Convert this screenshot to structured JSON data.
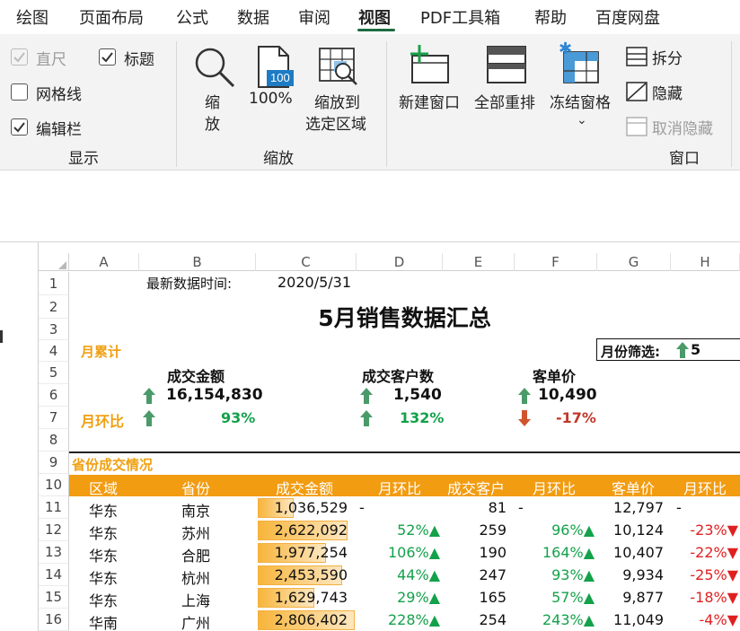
{
  "menu": {
    "items": [
      "绘图",
      "页面布局",
      "公式",
      "数据",
      "审阅",
      "视图",
      "PDF工具箱",
      "帮助",
      "百度网盘"
    ],
    "active": "视图"
  },
  "ribbon": {
    "show": {
      "ruler": "直尺",
      "headings": "标题",
      "gridlines": "网格线",
      "formula_bar": "编辑栏",
      "group_label": "显示"
    },
    "zoom": {
      "zoom_label_1": "缩",
      "zoom_label_2": "放",
      "percent_icon_text": "100",
      "percent_label": "100%",
      "zoom_sel_1": "缩放到",
      "zoom_sel_2": "选定区域",
      "group_label": "缩放"
    },
    "window": {
      "new_window": "新建窗口",
      "arrange_all": "全部重排",
      "freeze_panes": "冻结窗格",
      "split": "拆分",
      "hide": "隐藏",
      "unhide": "取消隐藏",
      "group_label": "窗口"
    }
  },
  "sheet": {
    "columns": [
      "A",
      "B",
      "C",
      "D",
      "E",
      "F",
      "G",
      "H"
    ],
    "rows": [
      "1",
      "2",
      "3",
      "4",
      "5",
      "6",
      "7",
      "8",
      "9",
      "10",
      "11",
      "12",
      "13",
      "14",
      "15",
      "16"
    ],
    "update_label": "最新数据时间:",
    "update_date": "2020/5/31",
    "title": "5月销售数据汇总",
    "cumulative_label": "月累计",
    "mom_label": "月环比",
    "filter_label": "月份筛选:",
    "filter_value": "5",
    "kpis": [
      {
        "label": "成交金额",
        "value": "16,154,830",
        "mom": "93%",
        "direction": "up"
      },
      {
        "label": "成交客户数",
        "value": "1,540",
        "mom": "132%",
        "direction": "up"
      },
      {
        "label": "客单价",
        "value": "10,490",
        "mom": "-17%",
        "direction": "down"
      }
    ],
    "section_title": "省份成交情况",
    "table_headers": [
      "区域",
      "省份",
      "成交金额",
      "月环比",
      "成交客户",
      "月环比",
      "客单价",
      "月环比"
    ],
    "table_rows": [
      {
        "region": "华东",
        "province": "南京",
        "amount": "1,036,529",
        "amount_bar": 0.37,
        "amount_mom": "-",
        "customers": "81",
        "cust_mom": "-",
        "price": "12,797",
        "price_mom": "-"
      },
      {
        "region": "华东",
        "province": "苏州",
        "amount": "2,622,092",
        "amount_bar": 0.93,
        "amount_mom": "52%▲",
        "customers": "259",
        "cust_mom": "96%▲",
        "price": "10,124",
        "price_mom": "-23%▼"
      },
      {
        "region": "华东",
        "province": "合肥",
        "amount": "1,977,254",
        "amount_bar": 0.7,
        "amount_mom": "106%▲",
        "customers": "190",
        "cust_mom": "164%▲",
        "price": "10,407",
        "price_mom": "-22%▼"
      },
      {
        "region": "华东",
        "province": "杭州",
        "amount": "2,453,590",
        "amount_bar": 0.87,
        "amount_mom": "44%▲",
        "customers": "247",
        "cust_mom": "93%▲",
        "price": "9,934",
        "price_mom": "-25%▼"
      },
      {
        "region": "华东",
        "province": "上海",
        "amount": "1,629,743",
        "amount_bar": 0.58,
        "amount_mom": "29%▲",
        "customers": "165",
        "cust_mom": "57%▲",
        "price": "9,877",
        "price_mom": "-18%▼"
      },
      {
        "region": "华南",
        "province": "广州",
        "amount": "2,806,402",
        "amount_bar": 1.0,
        "amount_mom": "228%▲",
        "customers": "254",
        "cust_mom": "243%▲",
        "price": "11,049",
        "price_mom": "-4%▼"
      }
    ]
  },
  "colors": {
    "accent_orange": "#f29c12",
    "positive_green": "#13a14a",
    "negative_red": "#e02020",
    "ribbon_bg": "#f3f3f3",
    "tab_underline": "#1d6b40"
  }
}
